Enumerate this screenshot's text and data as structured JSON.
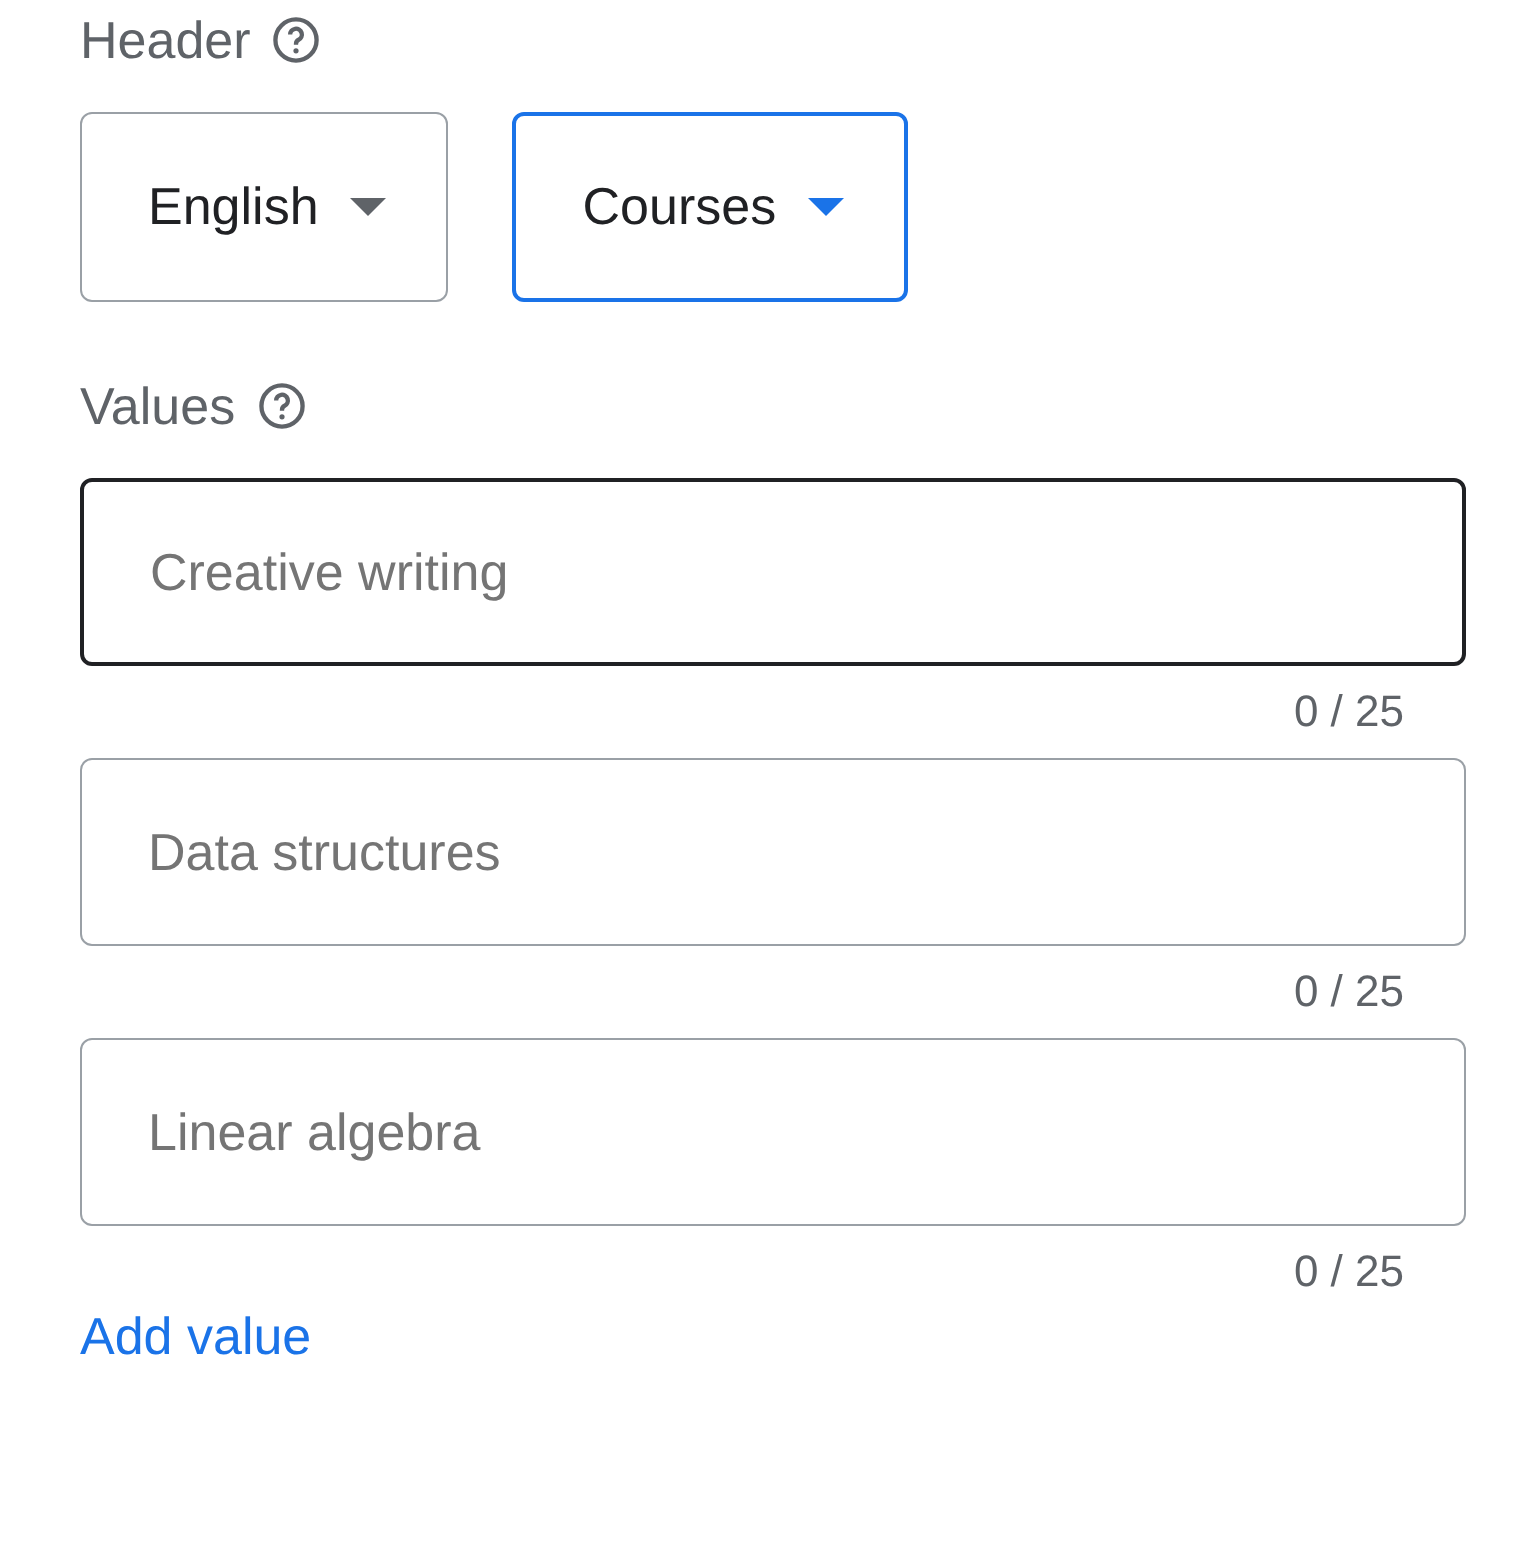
{
  "header": {
    "label": "Header",
    "dropdowns": [
      {
        "value": "English",
        "focused": false
      },
      {
        "value": "Courses",
        "focused": true
      }
    ]
  },
  "values": {
    "label": "Values",
    "fields": [
      {
        "placeholder": "Creative writing",
        "hovered": true,
        "counter": "0 / 25"
      },
      {
        "placeholder": "Data structures",
        "hovered": false,
        "counter": "0 / 25"
      },
      {
        "placeholder": "Linear algebra",
        "hovered": false,
        "counter": "0 / 25"
      }
    ]
  },
  "add_link": "Add value"
}
